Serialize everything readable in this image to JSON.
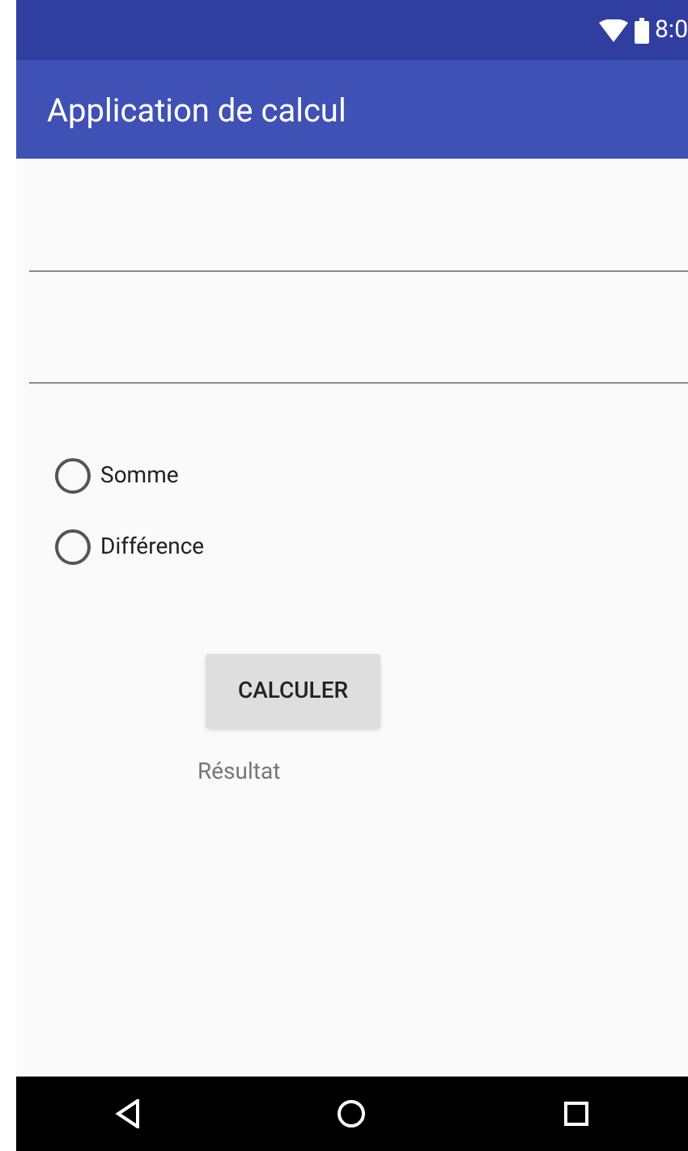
{
  "status_bar": {
    "time": "8:0"
  },
  "app_bar": {
    "title": "Application de calcul"
  },
  "fields": [
    {
      "kind": "text"
    },
    {
      "kind": "text"
    }
  ],
  "radios": [
    {
      "label": "Somme",
      "selected": false
    },
    {
      "label": "Différence",
      "selected": false
    }
  ],
  "button": {
    "label": "CALCULER"
  },
  "result": {
    "text": "Résultat"
  }
}
